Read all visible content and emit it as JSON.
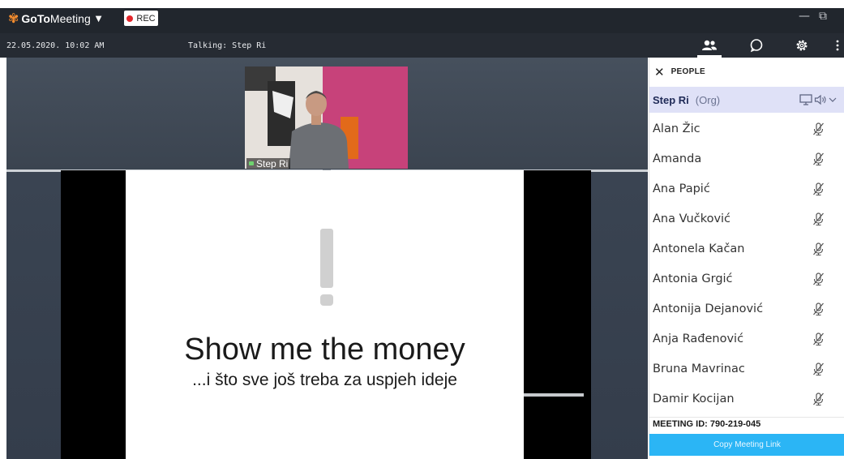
{
  "titlebar": {
    "brand_part1": "GoTo",
    "brand_part2": "Meeting",
    "rec_label": "REC",
    "minimize_glyph": "—",
    "restore_glyph": "⧉"
  },
  "status": {
    "datetime": "22.05.2020.  10:02 AM",
    "talking": "Talking: Step Ri"
  },
  "toolbar": {
    "items": [
      {
        "icon": "people-icon",
        "active": true
      },
      {
        "icon": "chat-icon",
        "active": false
      },
      {
        "icon": "settings-icon",
        "active": false
      }
    ]
  },
  "webcam": {
    "name": "Step Ri"
  },
  "slide": {
    "headline": "Show me the money",
    "subline": "...i što sve još treba za uspjeh ideje"
  },
  "people": {
    "title": "PEOPLE",
    "organizer": {
      "name": "Step Ri",
      "tag": "(Org)"
    },
    "attendees": [
      "Alan Žic",
      "Amanda",
      "Ana Papić",
      "Ana Vučković",
      "Antonela Kačan",
      "Antonia Grgić",
      "Antonija Dejanović",
      "Anja Rađenović",
      "Bruna Mavrinac",
      "Damir Kocijan"
    ],
    "meeting_id": "MEETING ID:  790-219-045",
    "copy_link": "Copy Meeting Link"
  },
  "colors": {
    "accent": "#2bb5f5",
    "organizer_row": "#dfe1f7",
    "titlebar": "#21262d",
    "rec_dot": "#e3262b",
    "brand_orange": "#f68d2e"
  }
}
